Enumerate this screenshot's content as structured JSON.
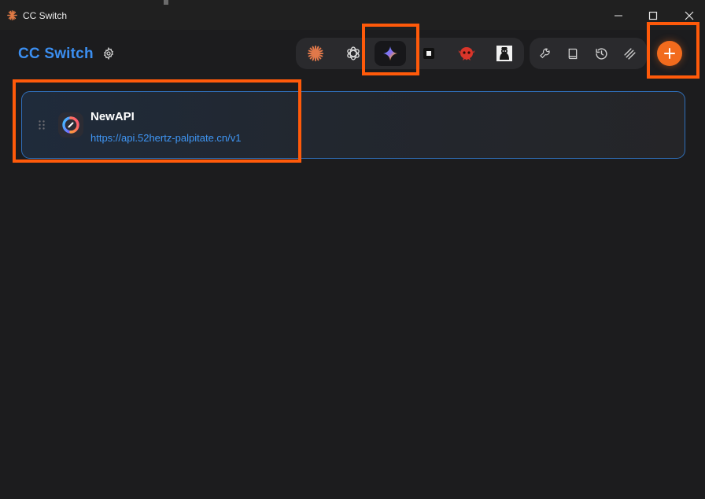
{
  "window": {
    "title": "CC Switch",
    "controls": [
      "minimize-icon",
      "maximize-icon",
      "close-icon"
    ]
  },
  "header": {
    "brand": "CC Switch",
    "settings_icon": "gear-icon"
  },
  "app_switcher": {
    "items": [
      {
        "icon": "claude-icon",
        "active": false
      },
      {
        "icon": "openai-icon",
        "active": false
      },
      {
        "icon": "gemini-icon",
        "active": true
      },
      {
        "icon": "square-app-icon",
        "active": false
      },
      {
        "icon": "red-mascot-icon",
        "active": false
      },
      {
        "icon": "portrait-app-icon",
        "active": false
      }
    ]
  },
  "tools": {
    "items": [
      "wrench-icon",
      "book-icon",
      "history-icon",
      "layers-icon"
    ]
  },
  "add_button_icon": "plus-icon",
  "providers": [
    {
      "name": "NewAPI",
      "url": "https://api.52hertz-palpitate.cn/v1"
    }
  ],
  "colors": {
    "accent": "#3b8ef0",
    "add_button": "#f26b1d",
    "highlight": "#ff5a0a",
    "background": "#1c1c1e"
  }
}
